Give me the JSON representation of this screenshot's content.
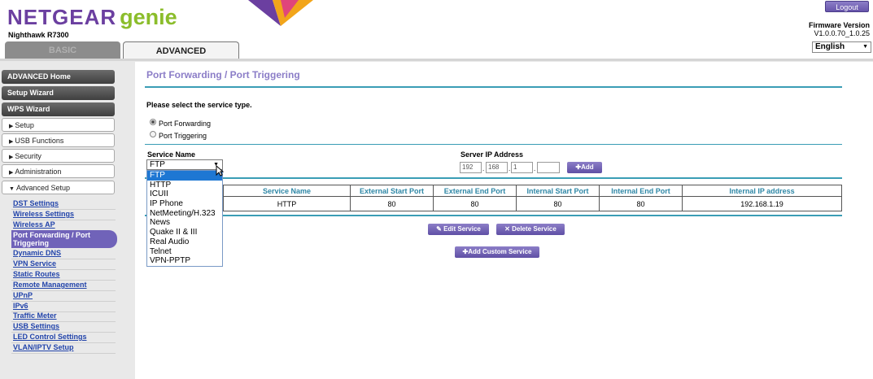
{
  "header": {
    "brand": "NETGEAR",
    "brand_suffix": "genie",
    "model": "Nighthawk R7300",
    "logout_label": "Logout",
    "firmware_label": "Firmware Version",
    "firmware_value": "V1.0.0.70_1.0.25",
    "language": "English",
    "colors": {
      "brand": "#6b3fa0",
      "genie": "#8bbd2b",
      "accent": "#7063b9"
    }
  },
  "tabs": [
    {
      "label": "BASIC"
    },
    {
      "label": "ADVANCED"
    }
  ],
  "sidebar": {
    "main_items": [
      "ADVANCED Home",
      "Setup Wizard",
      "WPS Wizard"
    ],
    "sections": [
      "Setup",
      "USB Functions",
      "Security",
      "Administration",
      "Advanced Setup"
    ],
    "sub_items": [
      "DST Settings",
      "Wireless Settings",
      "Wireless AP",
      "Port Forwarding / Port Triggering",
      "Dynamic DNS",
      "VPN Service",
      "Static Routes",
      "Remote Management",
      "UPnP",
      "IPv6",
      "Traffic Meter",
      "USB Settings",
      "LED Control Settings",
      "VLAN/IPTV Setup"
    ],
    "active_line1": "Port Forwarding / Port",
    "active_line2": "Triggering"
  },
  "main": {
    "title": "Port Forwarding / Port Triggering",
    "prompt": "Please select the service type.",
    "radio_forwarding": "Port Forwarding",
    "radio_triggering": "Port Triggering",
    "service_name_label": "Service Name",
    "service_selected": "FTP",
    "server_ip_label": "Server IP Address",
    "ip": [
      "192",
      "168",
      "1",
      ""
    ],
    "add_label": "Add",
    "dropdown_options": [
      "FTP",
      "HTTP",
      "ICUII",
      "IP Phone",
      "NetMeeting/H.323",
      "News",
      "Quake II & III",
      "Real Audio",
      "Telnet",
      "VPN-PPTP"
    ],
    "table": {
      "headers": [
        "Service Name",
        "External Start Port",
        "External End Port",
        "Internal Start Port",
        "Internal End Port",
        "Internal IP address"
      ],
      "row": [
        "HTTP",
        "80",
        "80",
        "80",
        "80",
        "192.168.1.19"
      ]
    },
    "edit_label": "Edit Service",
    "delete_label": "Delete Service",
    "add_custom_label": "Add Custom Service"
  }
}
